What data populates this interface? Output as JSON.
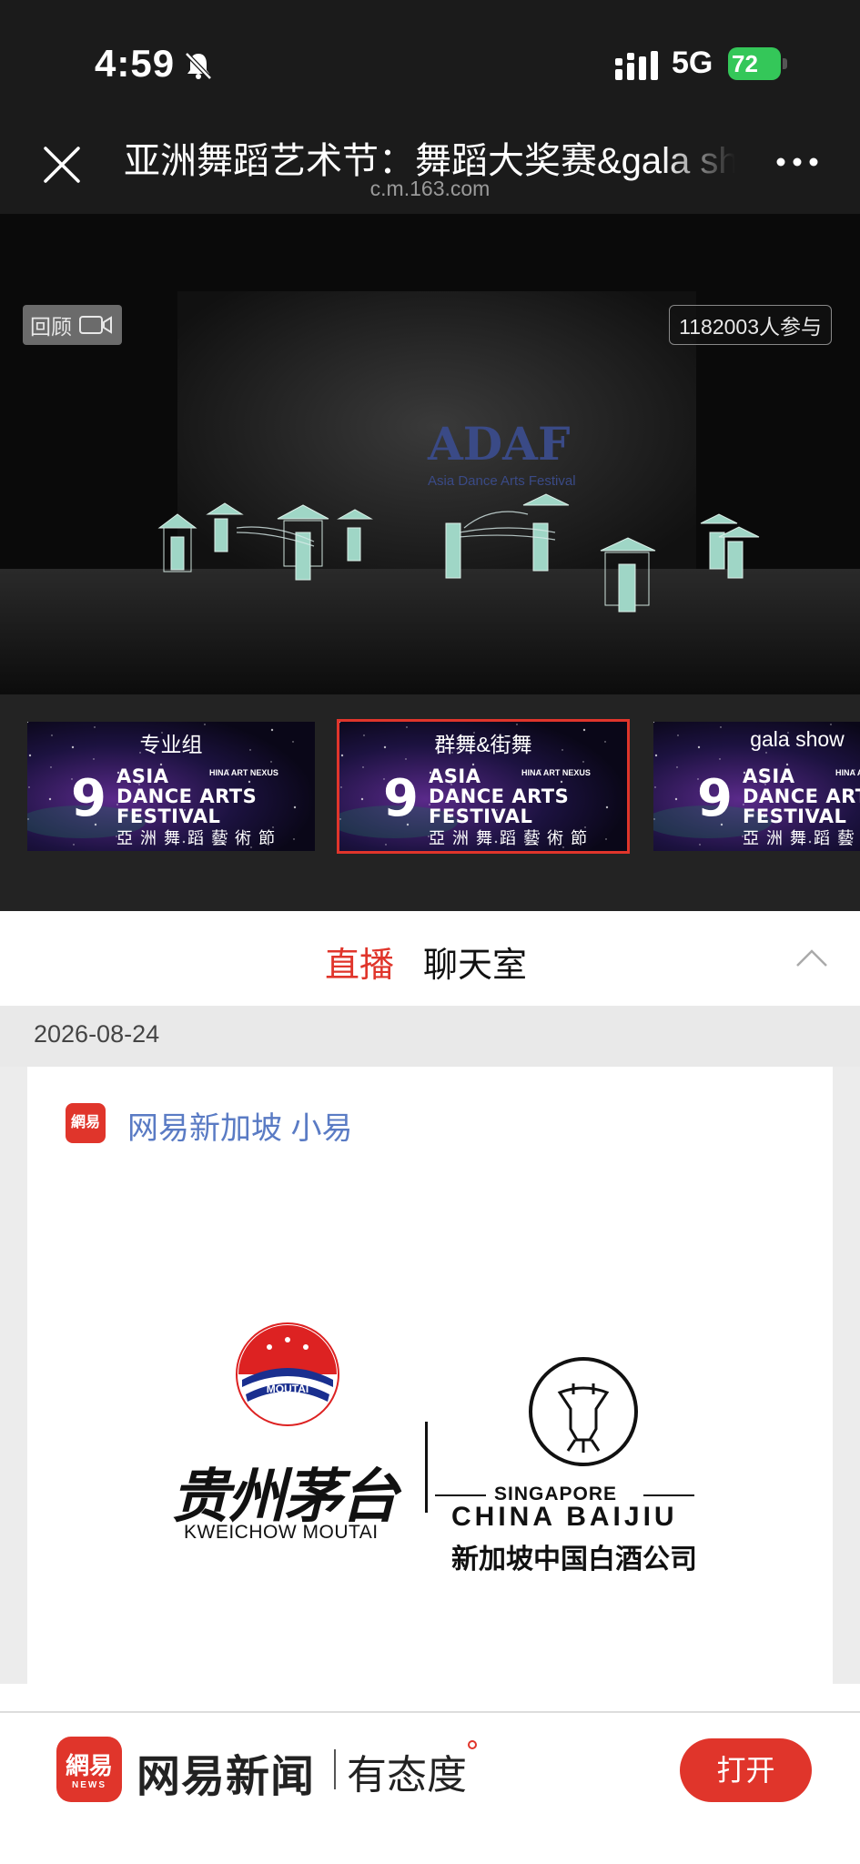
{
  "status_bar": {
    "time": "4:59",
    "network": "5G",
    "battery": "72",
    "battery_color": "#34c759"
  },
  "nav": {
    "title": "亚洲舞蹈艺术节：舞蹈大奖赛&gala show",
    "domain": "c.m.163.com",
    "close_icon": "close-icon",
    "more_icon": "more-icon"
  },
  "video": {
    "replay_label": "回顾",
    "viewers": "1182003人参与",
    "backdrop_logo": "ADAF",
    "backdrop_sub": "Asia Dance Arts Festival"
  },
  "playlist": [
    {
      "label": "专业组",
      "num": "9",
      "lines": [
        "ASIA",
        "DANCE ARTS",
        "FESTIVAL"
      ],
      "small": "HINA ART NEXUS",
      "cn": "亞洲舞蹈藝術節",
      "active": false
    },
    {
      "label": "群舞&街舞",
      "num": "9",
      "lines": [
        "ASIA",
        "DANCE ARTS",
        "FESTIVAL"
      ],
      "small": "HINA ART NEXUS",
      "cn": "亞洲舞蹈藝術節",
      "active": true
    },
    {
      "label": "gala show",
      "num": "9",
      "lines": [
        "ASIA",
        "DANCE ARTS",
        "FESTIVAL"
      ],
      "small": "HINA ART NEXUS",
      "cn": "亞洲舞蹈藝術節",
      "active": false
    }
  ],
  "tabs": {
    "live": "直播",
    "chat": "聊天室"
  },
  "feed": {
    "date": "2026-08-24",
    "author_avatar": "網易",
    "author": "网易新加坡 小易",
    "sponsor": {
      "moutai_badge": "MOUTAI",
      "moutai_cn": "贵州茅台",
      "moutai_en": "KWEICHOW MOUTAI",
      "sg_top": "SINGAPORE",
      "sg_main": "CHINA BAIJIU",
      "sg_cn": "新加坡中国白酒公司"
    }
  },
  "app_banner": {
    "logo_text": "網易",
    "logo_sub": "NEWS",
    "name": "网易新闻",
    "slogan": "有态度",
    "open_label": "打开",
    "accent": "#e0352b"
  }
}
